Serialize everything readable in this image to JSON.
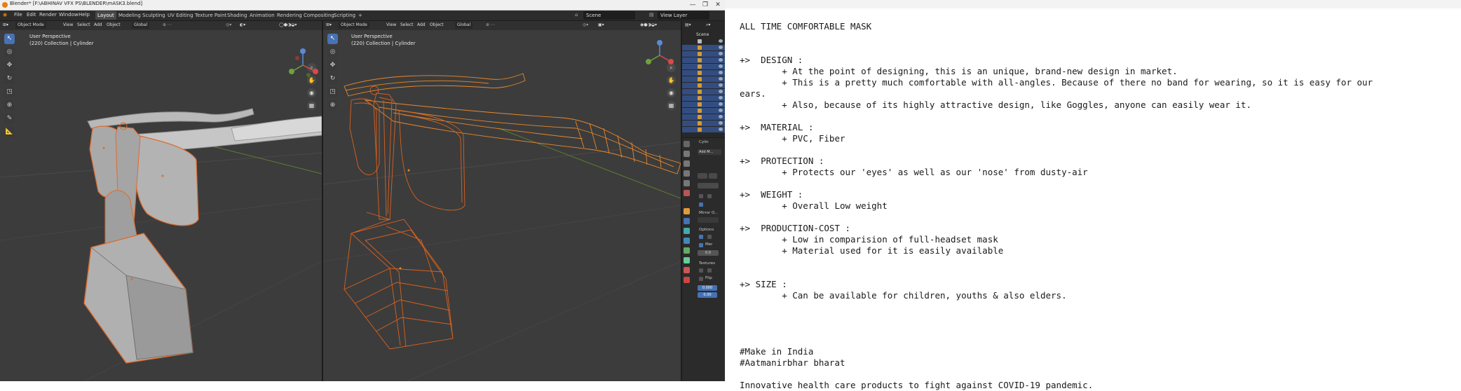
{
  "blender": {
    "title": "Blender* [F:\\ABHINAV VFX PS\\BLENDER\\mASK3.blend]",
    "window_buttons": [
      "—",
      "❐",
      "✕"
    ],
    "menu": [
      "File",
      "Edit",
      "Render",
      "Window",
      "Help"
    ],
    "workspaces": [
      "Layout",
      "Modeling",
      "Sculpting",
      "UV Editing",
      "Texture Paint",
      "Shading",
      "Animation",
      "Rendering",
      "Compositing",
      "Scripting",
      "+"
    ],
    "active_workspace": "Layout",
    "scene_label": "Scene",
    "view_layer_label": "View Layer",
    "viewport_left": {
      "mode": "Object Mode",
      "menus": [
        "View",
        "Select",
        "Add",
        "Object"
      ],
      "transform": "Global",
      "perspective": "User Perspective",
      "collection": "(220) Collection | Cylinder"
    },
    "viewport_right": {
      "mode": "Object Mode",
      "menus": [
        "View",
        "Select",
        "Add",
        "Object"
      ],
      "transform": "Global",
      "perspective": "User Perspective",
      "collection": "(220) Collection | Cylinder"
    },
    "outliner_header": "Scene",
    "properties": {
      "object_name": "Cylin",
      "modifier_btn": "Add M...",
      "mirror_label": "Mirror O...",
      "options_label": "Options",
      "mer_label": "Mer",
      "textures_label": "Textures",
      "flip_label": "Flip",
      "value1": "0.0",
      "offset1": "0.000",
      "offset2": "0.00"
    },
    "colors": {
      "accent_blue": "#4772b3",
      "wire_orange": "#e8892b",
      "selection_outline": "#e06a2c"
    }
  },
  "document": {
    "lines": [
      "ALL TIME COMFORTABLE MASK",
      "",
      "",
      "+>  DESIGN :",
      "        + At the point of designing, this is an unique, brand-new design in market.",
      "        + This is a pretty much comfortable with all-angles. Because of there no band for wearing, so it is easy for our",
      "ears.",
      "        + Also, because of its highly attractive design, like Goggles, anyone can easily wear it.",
      "",
      "+>  MATERIAL :",
      "        + PVC, Fiber",
      "",
      "+>  PROTECTION :",
      "        + Protects our 'eyes' as well as our 'nose' from dusty-air",
      "",
      "+>  WEIGHT :",
      "        + Overall Low weight",
      "",
      "+>  PRODUCTION-COST :",
      "        + Low in comparision of full-headset mask",
      "        + Material used for it is easily available",
      "",
      "",
      "+> SIZE :",
      "        + Can be available for children, youths & also elders.",
      "",
      "",
      "",
      "",
      "#Make in India",
      "#Aatmanirbhar bharat",
      "",
      "Innovative health care products to fight against COVID-19 pandemic."
    ]
  }
}
